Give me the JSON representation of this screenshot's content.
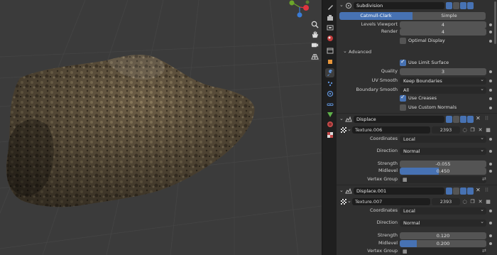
{
  "subdivision": {
    "name": "Subdivision",
    "tabs": [
      "Catmull-Clark",
      "Simple"
    ],
    "levels_viewport_label": "Levels Viewport",
    "levels_viewport": "4",
    "render_label": "Render",
    "render": "4",
    "optimal_display_label": "Optimal Display",
    "advanced_label": "Advanced",
    "use_limit_surface_label": "Use Limit Surface",
    "quality_label": "Quality",
    "quality": "3",
    "uv_smooth_label": "UV Smooth",
    "uv_smooth": "Keep Boundaries",
    "boundary_smooth_label": "Boundary Smooth",
    "boundary_smooth": "All",
    "use_creases_label": "Use Creases",
    "use_custom_normals_label": "Use Custom Normals"
  },
  "displace1": {
    "name": "Displace",
    "texture": "Texture.006",
    "texture_users": "2393",
    "coordinates_label": "Coordinates",
    "coordinates": "Local",
    "direction_label": "Direction",
    "direction": "Normal",
    "strength_label": "Strength",
    "strength": "-0.055",
    "midlevel_label": "Midlevel",
    "midlevel": "0.450",
    "midlevel_fraction": 0.45,
    "vertex_group_label": "Vertex Group"
  },
  "displace2": {
    "name": "Displace.001",
    "texture": "Texture.007",
    "texture_users": "2393",
    "coordinates_label": "Coordinates",
    "coordinates": "Local",
    "direction_label": "Direction",
    "direction": "Normal",
    "strength_label": "Strength",
    "strength": "0.120",
    "midlevel_label": "Midlevel",
    "midlevel": "0.200",
    "midlevel_fraction": 0.2,
    "vertex_group_label": "Vertex Group"
  },
  "colors": {
    "accent": "#4772b3",
    "gizmo_x": "#e0343f",
    "gizmo_y": "#6ca62a",
    "gizmo_z": "#3a7bd5"
  }
}
